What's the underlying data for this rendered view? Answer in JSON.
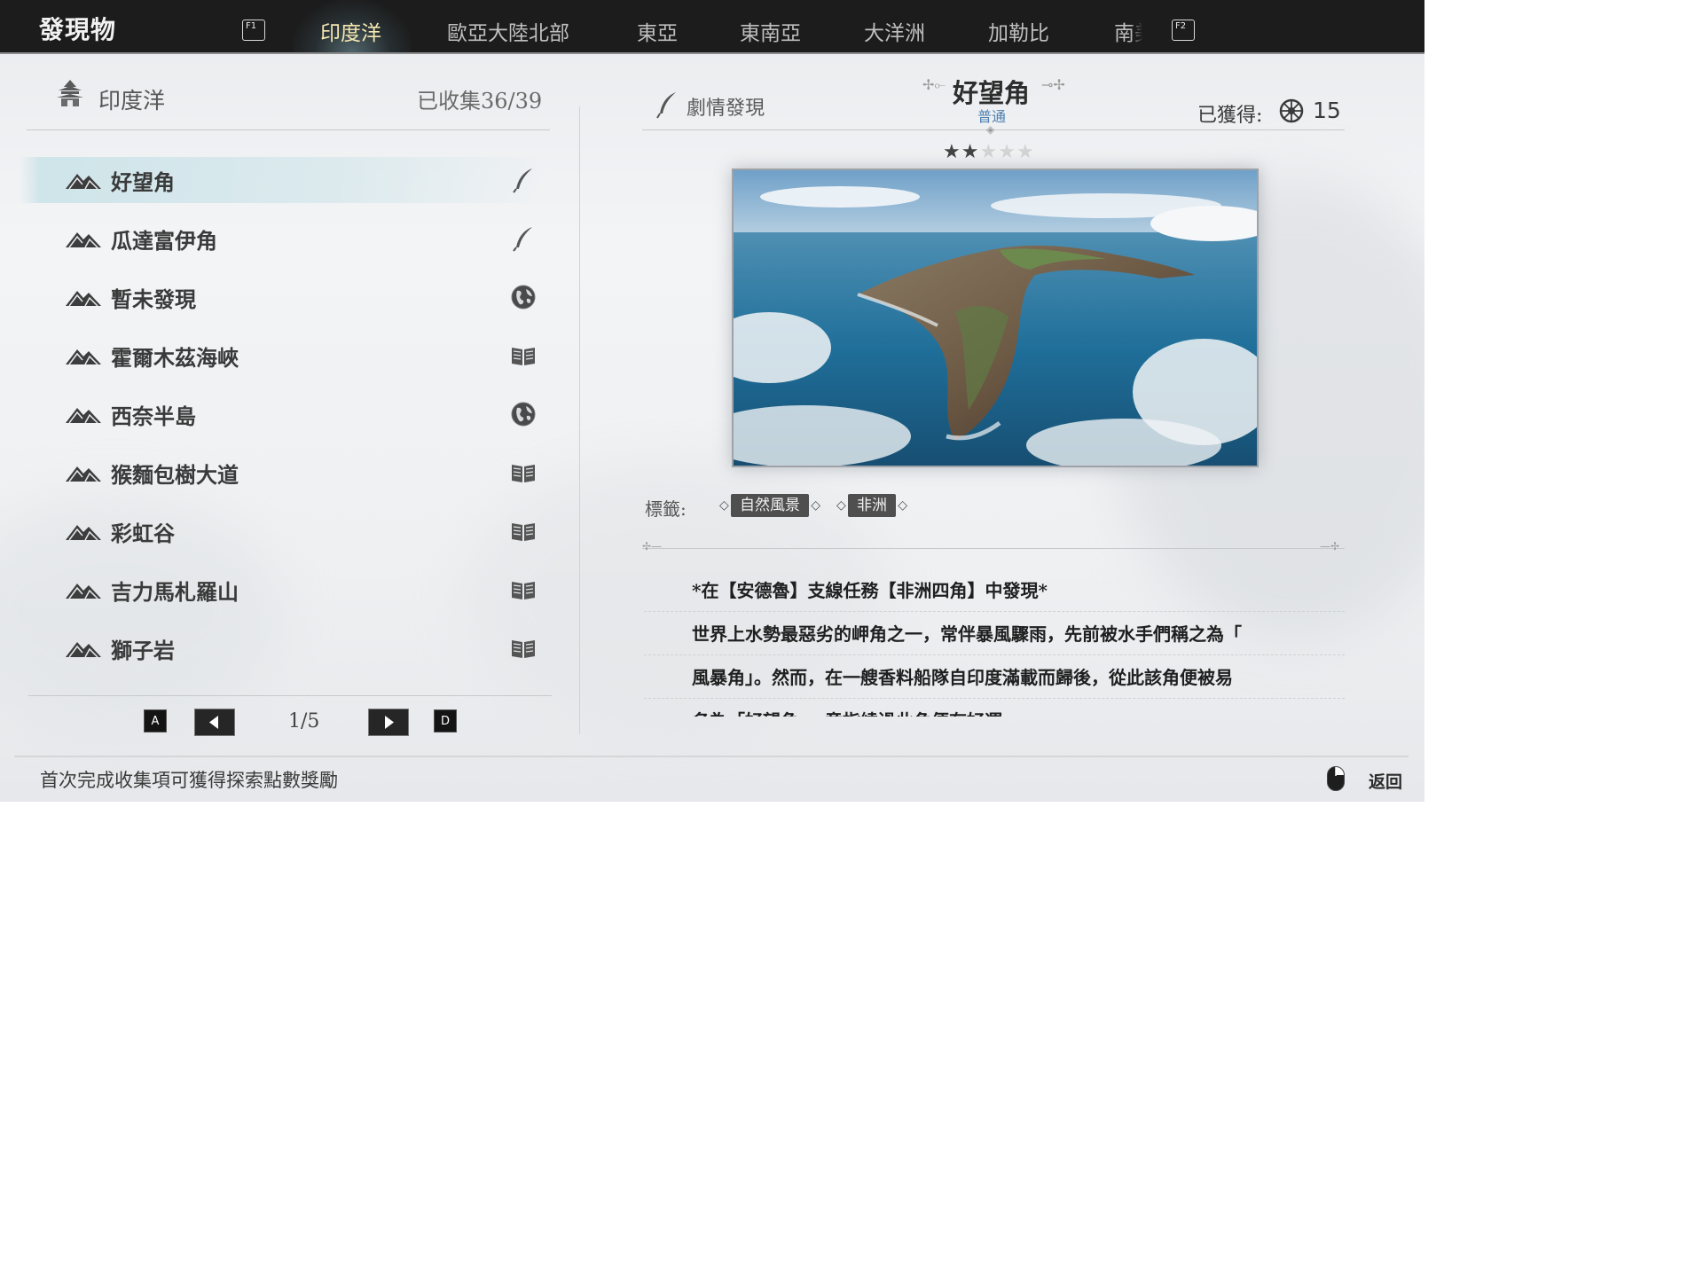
{
  "app": {
    "title": "發現物"
  },
  "keys": {
    "prev_tab": "F1",
    "next_tab": "F2",
    "prev_page": "A",
    "next_page": "D"
  },
  "tabs": [
    {
      "label": "印度洋",
      "active": true
    },
    {
      "label": "歐亞大陸北部",
      "active": false
    },
    {
      "label": "東亞",
      "active": false
    },
    {
      "label": "東南亞",
      "active": false
    },
    {
      "label": "大洋洲",
      "active": false
    },
    {
      "label": "加勒比",
      "active": false
    },
    {
      "label": "南美",
      "active": false
    }
  ],
  "left": {
    "region": "印度洋",
    "collected": "已收集36/39",
    "items": [
      {
        "label": "好望角",
        "icon": "feather-icon",
        "selected": true
      },
      {
        "label": "瓜達富伊角",
        "icon": "feather-icon",
        "selected": false
      },
      {
        "label": "暫未發現",
        "icon": "globe-icon",
        "selected": false
      },
      {
        "label": "霍爾木茲海峽",
        "icon": "book-icon",
        "selected": false
      },
      {
        "label": "西奈半島",
        "icon": "globe-icon",
        "selected": false
      },
      {
        "label": "猴麵包樹大道",
        "icon": "book-icon",
        "selected": false
      },
      {
        "label": "彩虹谷",
        "icon": "book-icon",
        "selected": false
      },
      {
        "label": "吉力馬札羅山",
        "icon": "book-icon",
        "selected": false
      },
      {
        "label": "獅子岩",
        "icon": "book-icon",
        "selected": false
      }
    ],
    "page": "1/5"
  },
  "detail": {
    "category": "劇情發現",
    "title": "好望角",
    "rarity": "普通",
    "obtained_label": "已獲得:",
    "obtained_value": "15",
    "stars": {
      "filled": 2,
      "total": 5
    },
    "tags_label": "標籤:",
    "tags": [
      "自然風景",
      "非洲"
    ],
    "description": [
      "*在【安德魯】支線任務【非洲四角】中發現*",
      "世界上水勢最惡劣的岬角之一，常伴暴風驟雨，先前被水手們稱之為「",
      "風暴角」。然而，在一艘香料船隊自印度滿載而歸後，從此該角便被易",
      "名為「好望角」，意指繞過此角便有好運"
    ]
  },
  "footer": {
    "hint": "首次完成收集項可獲得探索點數獎勵",
    "back": "返回"
  },
  "colors": {
    "topbar": "#1c1c1c",
    "active_tab": "#f4e7b0",
    "rarity": "#4d7fb0",
    "tag_bg": "#4f4f4f"
  }
}
